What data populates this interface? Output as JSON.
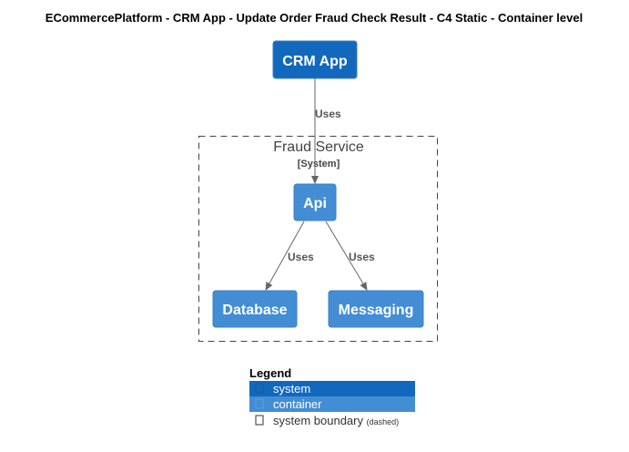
{
  "title": "ECommercePlatform - CRM App - Update Order Fraud Check Result - C4 Static - Container level",
  "colors": {
    "system": "#1168bd",
    "container": "#438dd5",
    "boundary": "#444444",
    "edge": "#666666",
    "edge_label": "#555555"
  },
  "nodes": {
    "crm_app": {
      "label": "CRM App"
    },
    "api": {
      "label": "Api"
    },
    "database": {
      "label": "Database"
    },
    "messaging": {
      "label": "Messaging"
    }
  },
  "boundary": {
    "name": "Fraud Service",
    "type": "[System]"
  },
  "edges": {
    "crm_to_api": {
      "label": "Uses"
    },
    "api_to_database": {
      "label": "Uses"
    },
    "api_to_messaging": {
      "label": "Uses"
    }
  },
  "legend": {
    "title": "Legend",
    "items": [
      {
        "label": "system",
        "icon": "square-icon"
      },
      {
        "label": "container",
        "icon": "square-icon"
      },
      {
        "label": "system boundary",
        "note": "(dashed)",
        "icon": "square-icon"
      }
    ]
  }
}
